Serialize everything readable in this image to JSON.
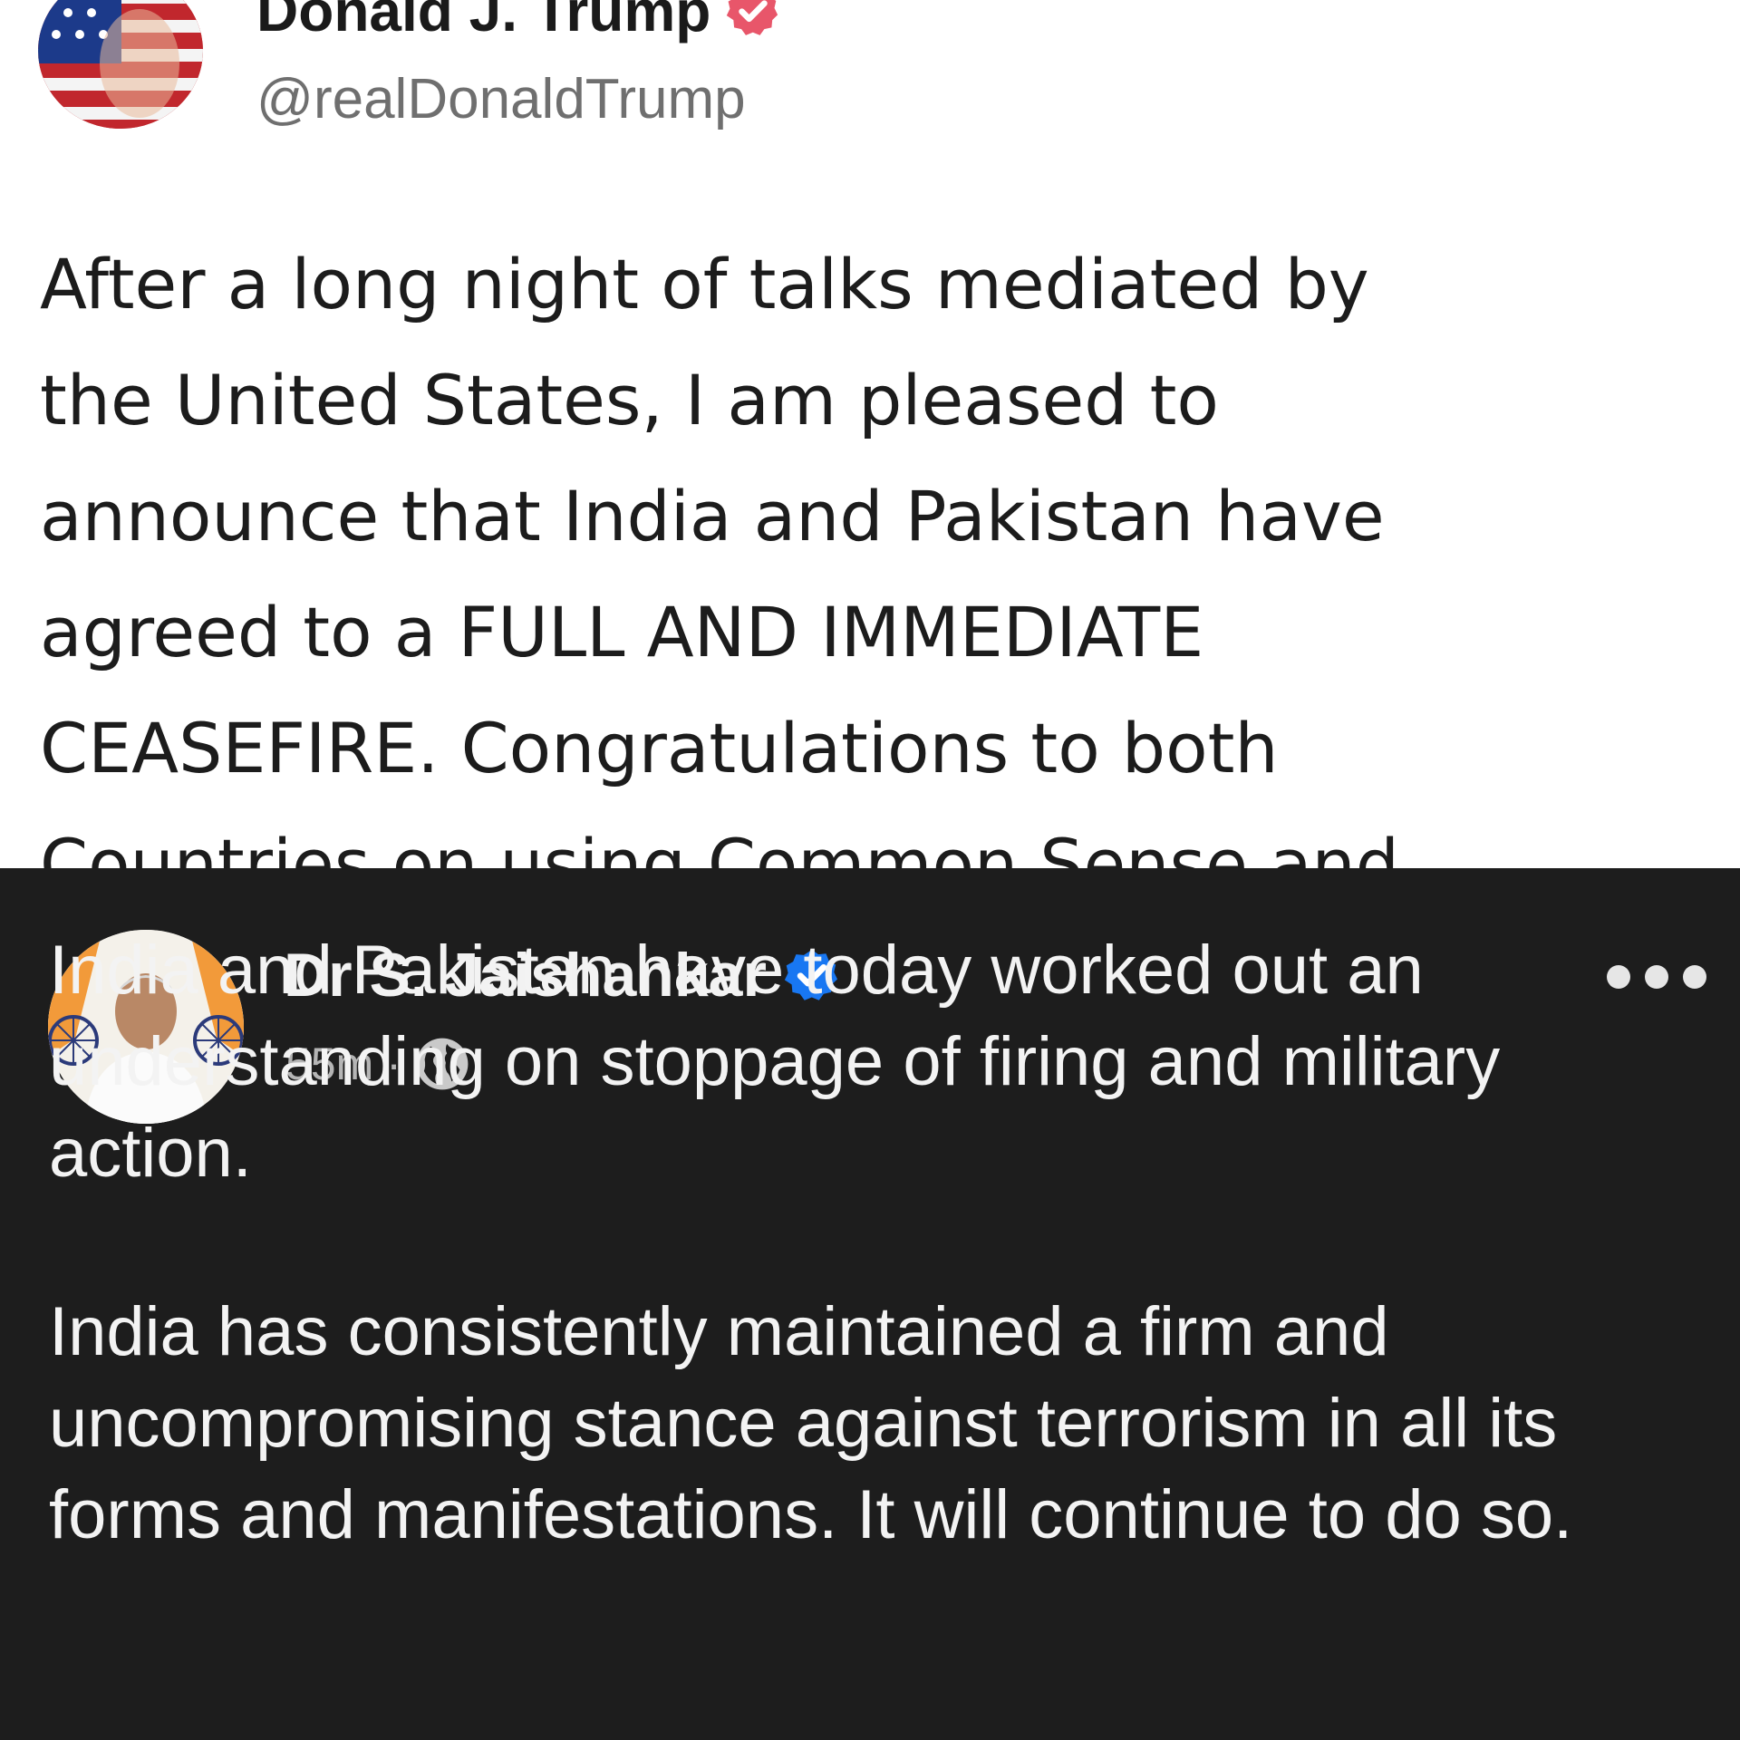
{
  "post_top": {
    "author_name": "Donald J. Trump",
    "handle": "@realDonaldTrump",
    "text_lines": [
      "After a long night of talks mediated by",
      "the United States, I am pleased to",
      "announce that India and Pakistan have",
      "agreed to a FULL AND IMMEDIATE",
      "CEASEFIRE. Congratulations to both",
      "Countries on using Common Sense and"
    ],
    "badge_color": "#e8566a"
  },
  "post_bottom": {
    "author_name": "Dr S. Jaishankar",
    "time": "55m",
    "separator": "·",
    "visibility_icon": "globe-icon",
    "more_icon": "more-options-icon",
    "paragraph_1_lines": [
      "India and Pakistan have today worked out an",
      "understanding on stoppage of firing and military",
      "action."
    ],
    "paragraph_2_lines": [
      "India has consistently maintained a firm and",
      "uncompromising stance against terrorism in all its",
      "forms and manifestations. It will continue to do so."
    ],
    "badge_color": "#1877f2"
  }
}
